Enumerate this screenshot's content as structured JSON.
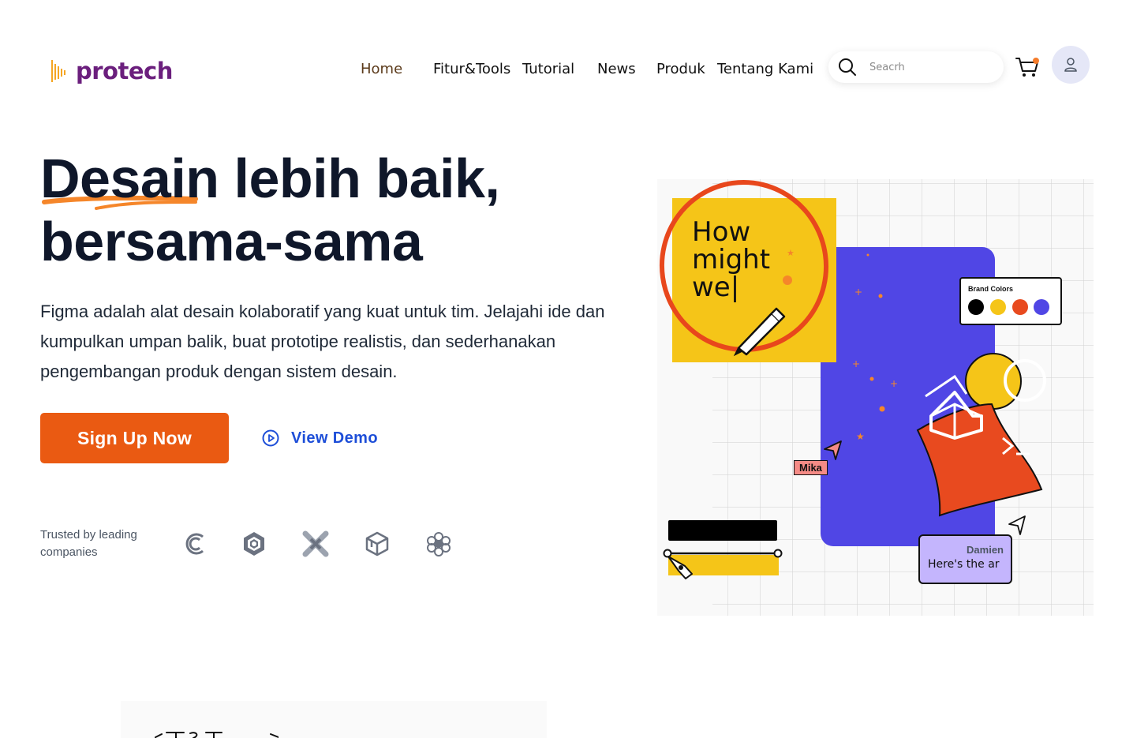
{
  "brand": {
    "name": "protech",
    "color": "#6b1f7d",
    "accent": "#f5a623"
  },
  "nav": {
    "items": [
      {
        "label": "Home",
        "active": true
      },
      {
        "label": "Fitur&Tools",
        "active": false
      },
      {
        "label": "Tutorial",
        "active": false
      },
      {
        "label": "News",
        "active": false
      },
      {
        "label": "Produk",
        "active": false
      },
      {
        "label": "Tentang Kami",
        "active": false
      }
    ],
    "search_placeholder": "Seacrh",
    "cart_icon": "cart-icon",
    "user_icon": "user-icon"
  },
  "hero": {
    "headline_line1_highlight": "Desain",
    "headline_line1_rest": " lebih baik,",
    "headline_line2": "bersama-sama",
    "description": "Figma adalah alat desain kolaboratif yang kuat untuk tim. Jelajahi ide dan kumpulkan umpan balik, buat prototipe realistis, dan sederhanakan pengembangan produk dengan sistem desain.",
    "signup_label": "Sign Up Now",
    "demo_label": "View Demo",
    "trusted_label": "Trusted by leading companies",
    "companies": [
      "company-logo-c",
      "company-logo-hexagon",
      "company-logo-cross",
      "company-logo-cube",
      "company-logo-cluster"
    ]
  },
  "illustration": {
    "sticky_text": "How might we|",
    "brand_colors_label": "Brand Colors",
    "brand_colors": [
      "#000000",
      "#f5c518",
      "#e84a1f",
      "#5046e5"
    ],
    "cursor_mika": "Mika",
    "cursor_damien": "Damien",
    "damien_message": "Here's the ar"
  },
  "colors": {
    "primary_button": "#ea5a12",
    "link": "#1d4ed8",
    "headline": "#0f172a"
  }
}
